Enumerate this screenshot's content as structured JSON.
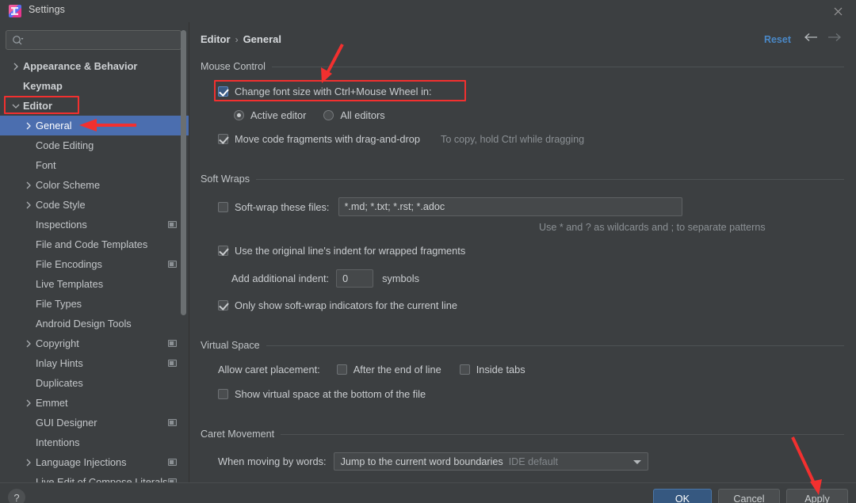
{
  "window": {
    "title": "Settings",
    "app_icon": "intellij-idea-icon",
    "close_icon": "close-icon"
  },
  "search": {
    "value": "",
    "placeholder": "",
    "icon": "search-icon"
  },
  "sidebar": {
    "items": [
      {
        "label": "Appearance & Behavior",
        "level": 0,
        "chevron": "chevron-right",
        "selected": false,
        "badge": false
      },
      {
        "label": "Keymap",
        "level": 0,
        "chevron": "",
        "selected": false,
        "badge": false
      },
      {
        "label": "Editor",
        "level": 0,
        "chevron": "chevron-down",
        "selected": false,
        "badge": false
      },
      {
        "label": "General",
        "level": 1,
        "chevron": "chevron-right",
        "selected": true,
        "badge": false
      },
      {
        "label": "Code Editing",
        "level": 1,
        "chevron": "",
        "selected": false,
        "badge": false
      },
      {
        "label": "Font",
        "level": 1,
        "chevron": "",
        "selected": false,
        "badge": false
      },
      {
        "label": "Color Scheme",
        "level": 1,
        "chevron": "chevron-right",
        "selected": false,
        "badge": false
      },
      {
        "label": "Code Style",
        "level": 1,
        "chevron": "chevron-right",
        "selected": false,
        "badge": false
      },
      {
        "label": "Inspections",
        "level": 1,
        "chevron": "",
        "selected": false,
        "badge": true
      },
      {
        "label": "File and Code Templates",
        "level": 1,
        "chevron": "",
        "selected": false,
        "badge": false
      },
      {
        "label": "File Encodings",
        "level": 1,
        "chevron": "",
        "selected": false,
        "badge": true
      },
      {
        "label": "Live Templates",
        "level": 1,
        "chevron": "",
        "selected": false,
        "badge": false
      },
      {
        "label": "File Types",
        "level": 1,
        "chevron": "",
        "selected": false,
        "badge": false
      },
      {
        "label": "Android Design Tools",
        "level": 1,
        "chevron": "",
        "selected": false,
        "badge": false
      },
      {
        "label": "Copyright",
        "level": 1,
        "chevron": "chevron-right",
        "selected": false,
        "badge": true
      },
      {
        "label": "Inlay Hints",
        "level": 1,
        "chevron": "",
        "selected": false,
        "badge": true
      },
      {
        "label": "Duplicates",
        "level": 1,
        "chevron": "",
        "selected": false,
        "badge": false
      },
      {
        "label": "Emmet",
        "level": 1,
        "chevron": "chevron-right",
        "selected": false,
        "badge": false
      },
      {
        "label": "GUI Designer",
        "level": 1,
        "chevron": "",
        "selected": false,
        "badge": true
      },
      {
        "label": "Intentions",
        "level": 1,
        "chevron": "",
        "selected": false,
        "badge": false
      },
      {
        "label": "Language Injections",
        "level": 1,
        "chevron": "chevron-right",
        "selected": false,
        "badge": true
      },
      {
        "label": "Live Edit of Compose Literals",
        "level": 1,
        "chevron": "",
        "selected": false,
        "badge": true
      }
    ]
  },
  "header": {
    "breadcrumb_root": "Editor",
    "breadcrumb_separator": "›",
    "breadcrumb_leaf": "General",
    "reset_label": "Reset",
    "back_icon": "arrow-left-icon",
    "forward_icon": "arrow-right-icon"
  },
  "mouse_control": {
    "title": "Mouse Control",
    "change_font_size": {
      "label": "Change font size with Ctrl+Mouse Wheel in:",
      "checked": true
    },
    "scope_options": [
      {
        "label": "Active editor",
        "selected": true
      },
      {
        "label": "All editors",
        "selected": false
      }
    ],
    "drag_and_drop": {
      "label": "Move code fragments with drag-and-drop",
      "checked": true
    },
    "drag_hint": "To copy, hold Ctrl while dragging"
  },
  "soft_wraps": {
    "title": "Soft Wraps",
    "soft_wrap_files": {
      "label": "Soft-wrap these files:",
      "checked": false,
      "value": "*.md; *.txt; *.rst; *.adoc"
    },
    "wildcard_hint": "Use * and ? as wildcards and ; to separate patterns",
    "original_indent": {
      "label": "Use the original line's indent for wrapped fragments",
      "checked": true
    },
    "additional_indent": {
      "label": "Add additional indent:",
      "value": "0",
      "suffix": "symbols"
    },
    "indicators_current_line": {
      "label": "Only show soft-wrap indicators for the current line",
      "checked": true
    }
  },
  "virtual_space": {
    "title": "Virtual Space",
    "caret_placement_label": "Allow caret placement:",
    "after_end_of_line": {
      "label": "After the end of line",
      "checked": false
    },
    "inside_tabs": {
      "label": "Inside tabs",
      "checked": false
    },
    "show_virtual_space": {
      "label": "Show virtual space at the bottom of the file",
      "checked": false
    }
  },
  "caret_movement": {
    "title": "Caret Movement",
    "when_moving_by_words_label": "When moving by words:",
    "when_moving_by_words_value": "Jump to the current word boundaries",
    "when_moving_by_words_hint": "IDE default"
  },
  "footer": {
    "help_label": "?",
    "ok_label": "OK",
    "cancel_label": "Cancel",
    "apply_label": "Apply"
  },
  "annotations": {
    "highlight_color": "#f2302f"
  }
}
